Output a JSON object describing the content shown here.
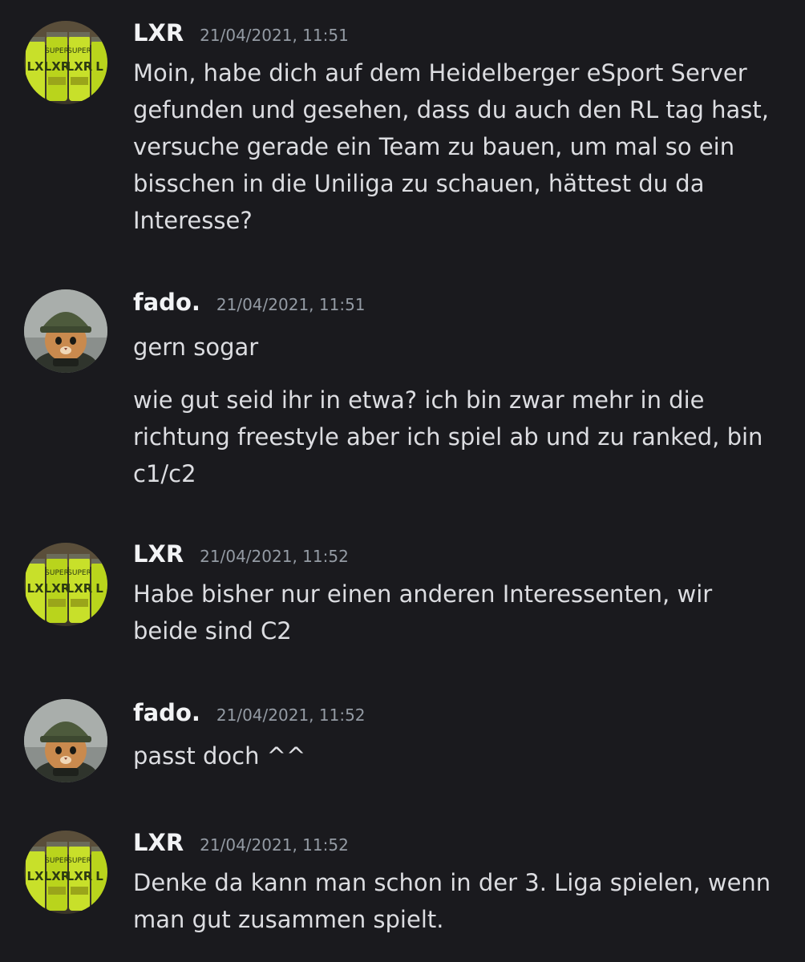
{
  "messages": [
    {
      "author": "LXR",
      "timestamp": "21/04/2021, 11:51",
      "avatar_icon": "energy-drink-cans-avatar",
      "paragraphs": [
        "Moin, habe dich auf dem Heidelberger eSport Server gefunden und gesehen, dass du auch den RL tag hast, versuche gerade ein Team zu bauen, um mal so ein bisschen in die Uniliga zu schauen, hättest du da Interesse?"
      ]
    },
    {
      "author": "fado.",
      "timestamp": "21/04/2021, 11:51",
      "avatar_icon": "cat-with-helmet-avatar",
      "paragraphs": [
        "gern sogar",
        "wie gut seid ihr in etwa? ich bin zwar mehr in die richtung freestyle aber ich spiel ab und zu ranked, bin c1/c2"
      ]
    },
    {
      "author": "LXR",
      "timestamp": "21/04/2021, 11:52",
      "avatar_icon": "energy-drink-cans-avatar",
      "paragraphs": [
        "Habe bisher nur einen anderen Interessenten, wir beide sind C2"
      ]
    },
    {
      "author": "fado.",
      "timestamp": "21/04/2021, 11:52",
      "avatar_icon": "cat-with-helmet-avatar",
      "paragraphs": [
        "passt doch ^^"
      ]
    },
    {
      "author": "LXR",
      "timestamp": "21/04/2021, 11:52",
      "avatar_icon": "energy-drink-cans-avatar",
      "paragraphs": [
        "Denke da kann man schon in der 3. Liga spielen, wenn man gut zusammen spielt."
      ]
    }
  ],
  "avatar_lettering": {
    "can_label_top": "SUPER",
    "can_label_main": "LXR"
  },
  "colors": {
    "background": "#1a1a1e",
    "username": "#f2f3f5",
    "timestamp": "#949ba4",
    "message_text": "#dcdde1",
    "can_green": "#c8e02a",
    "can_dark": "#2d3a12"
  }
}
